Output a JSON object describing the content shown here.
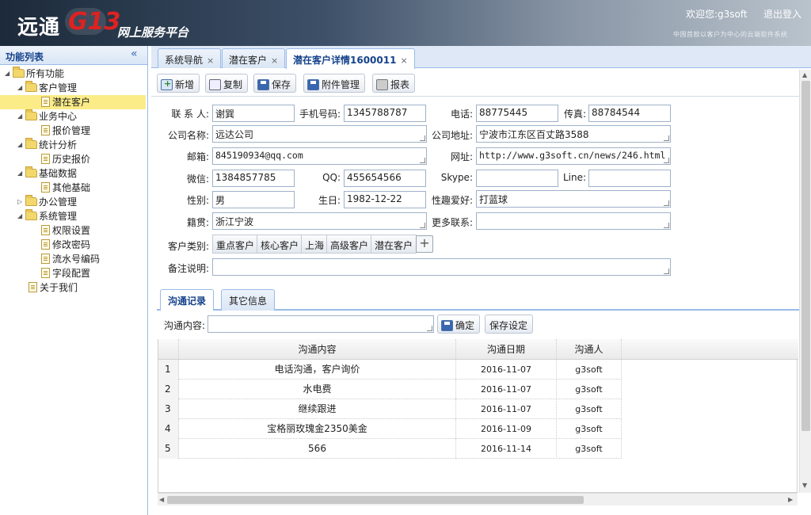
{
  "header": {
    "logo_main": "远通",
    "logo_brand": "G13",
    "logo_subtitle": "网上服务平台",
    "welcome": "欢迎您:g3soft",
    "logout": "退出登入",
    "slogan": "中国首款以客户为中心的云端软件系统"
  },
  "sidebar": {
    "title": "功能列表",
    "collapse_icon": "double-chevron-left-icon",
    "nodes": [
      {
        "label": "所有功能",
        "type": "folder",
        "expanded": true
      },
      {
        "label": "客户管理",
        "type": "folder",
        "expanded": true
      },
      {
        "label": "潜在客户",
        "type": "file",
        "selected": true
      },
      {
        "label": "业务中心",
        "type": "folder",
        "expanded": true
      },
      {
        "label": "报价管理",
        "type": "file"
      },
      {
        "label": "统计分析",
        "type": "folder",
        "expanded": true
      },
      {
        "label": "历史报价",
        "type": "file"
      },
      {
        "label": "基础数据",
        "type": "folder",
        "expanded": true
      },
      {
        "label": "其他基础",
        "type": "file"
      },
      {
        "label": "办公管理",
        "type": "folder",
        "expanded": false
      },
      {
        "label": "系统管理",
        "type": "folder",
        "expanded": true
      },
      {
        "label": "权限设置",
        "type": "file"
      },
      {
        "label": "修改密码",
        "type": "file"
      },
      {
        "label": "流水号编码",
        "type": "file"
      },
      {
        "label": "字段配置",
        "type": "file"
      },
      {
        "label": "关于我们",
        "type": "file"
      }
    ]
  },
  "tabs": [
    {
      "label": "系统导航",
      "close": "×"
    },
    {
      "label": "潜在客户",
      "close": "×"
    },
    {
      "label": "潜在客户详情1600011",
      "close": "×",
      "active": true
    }
  ],
  "toolbar": {
    "new": "新增",
    "copy": "复制",
    "save": "保存",
    "attach": "附件管理",
    "report": "报表"
  },
  "form": {
    "contact_label": "联 系 人:",
    "contact": "谢巽",
    "mobile_label": "手机号码:",
    "mobile": "1345788787",
    "phone_label": "电话:",
    "phone": "88775445",
    "fax_label": "传真:",
    "fax": "88784544",
    "company_label": "公司名称:",
    "company": "远达公司",
    "address_label": "公司地址:",
    "address": "宁波市江东区百丈路3588",
    "email_label": "邮箱:",
    "email": "845190934@qq.com",
    "website_label": "网址:",
    "website": "http://www.g3soft.cn/news/246.html",
    "wechat_label": "微信:",
    "wechat": "1384857785",
    "qq_label": "QQ:",
    "qq": "455654566",
    "skype_label": "Skype:",
    "skype": "",
    "line_label": "Line:",
    "line": "",
    "gender_label": "性别:",
    "gender": "男",
    "birthday_label": "生日:",
    "birthday": "1982-12-22",
    "hobby_label": "性趣爱好:",
    "hobby": "打蓝球",
    "origin_label": "籍贯:",
    "origin": "浙江宁波",
    "more_label": "更多联系:",
    "more": "",
    "category_label": "客户类别:",
    "categories": [
      "重点客户",
      "核心客户",
      "上海",
      "高级客户",
      "潜在客户"
    ],
    "add_category": "+",
    "remark_label": "备注说明:",
    "remark": ""
  },
  "subtabs": [
    {
      "label": "沟通记录",
      "active": true
    },
    {
      "label": "其它信息"
    }
  ],
  "comm": {
    "content_label": "沟通内容:",
    "content_value": "",
    "confirm": "确定",
    "save_settings": "保存设定"
  },
  "grid": {
    "columns": [
      "沟通内容",
      "沟通日期",
      "沟通人"
    ],
    "rows": [
      {
        "no": "1",
        "content": "电话沟通，客户询价",
        "date": "2016-11-07",
        "person": "g3soft"
      },
      {
        "no": "2",
        "content": "水电费",
        "date": "2016-11-07",
        "person": "g3soft"
      },
      {
        "no": "3",
        "content": "继续跟进",
        "date": "2016-11-07",
        "person": "g3soft"
      },
      {
        "no": "4",
        "content": "宝格丽玫瑰金2350美金",
        "date": "2016-11-09",
        "person": "g3soft"
      },
      {
        "no": "5",
        "content": "566",
        "date": "2016-11-14",
        "person": "g3soft"
      }
    ]
  }
}
